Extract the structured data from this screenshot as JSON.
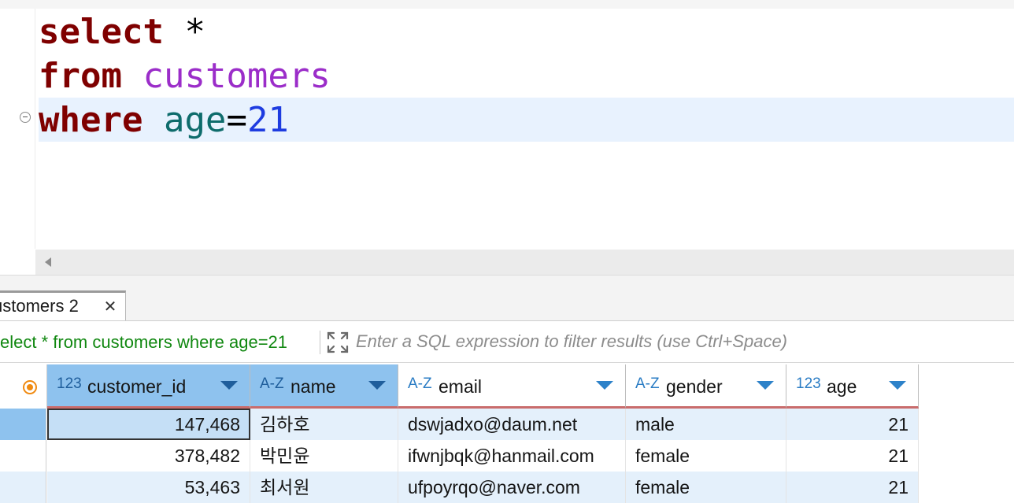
{
  "editor": {
    "line1": {
      "kw": "select",
      "rest": " *"
    },
    "line2": {
      "kw": "from",
      "table": "customers"
    },
    "line3": {
      "kw": "where",
      "column": "age",
      "op": "=",
      "value": "21"
    }
  },
  "results": {
    "tab_label": "ustomers 2",
    "tab_close_icon": "close-icon",
    "query_text": "elect * from customers where age=21",
    "filter_placeholder": "Enter a SQL expression to filter results (use Ctrl+Space)",
    "columns": [
      {
        "type": "123",
        "name": "customer_id"
      },
      {
        "type": "A-Z",
        "name": "name"
      },
      {
        "type": "A-Z",
        "name": "email"
      },
      {
        "type": "A-Z",
        "name": "gender"
      },
      {
        "type": "123",
        "name": "age"
      }
    ],
    "rows": [
      {
        "customer_id": "147,468",
        "name": "김하호",
        "email": "dswjadxo@daum.net",
        "gender": "male",
        "age": "21"
      },
      {
        "customer_id": "378,482",
        "name": "박민윤",
        "email": "ifwnjbqk@hanmail.com",
        "gender": "female",
        "age": "21"
      },
      {
        "customer_id": "53,463",
        "name": "최서원",
        "email": "ufpoyrqo@naver.com",
        "gender": "female",
        "age": "21"
      }
    ]
  },
  "colors": {
    "keyword": "#7f0000",
    "table": "#9b2dc9",
    "column": "#0e6c6c",
    "number": "#1e3ce0",
    "selected_header": "#8ec2ee",
    "filter_query": "#118811"
  }
}
